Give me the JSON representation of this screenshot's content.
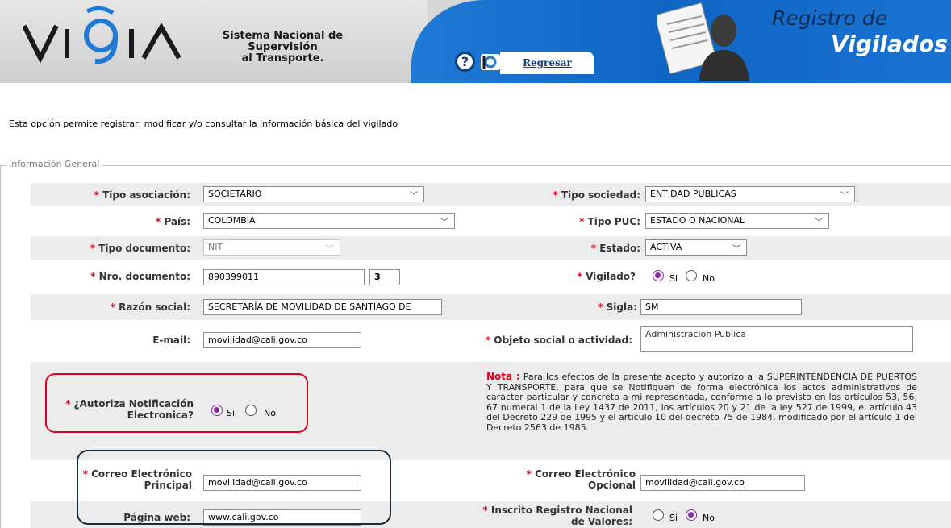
{
  "header": {
    "logo_text_line1": "Sistema Nacional de Supervisión",
    "logo_text_line2": "al Transporte.",
    "help_icon": "question-icon",
    "regresar_label": "Regresar",
    "title_line1": "Registro de",
    "title_line2": "Vigilados"
  },
  "intro_text": "Esta opción permite registrar, modificar y/o consultar la información básica del vigilado",
  "legend": "Información General",
  "required_mark": "*",
  "form": {
    "tipo_asociacion": {
      "label": "Tipo asociación:",
      "value": "SOCIETARIO"
    },
    "tipo_sociedad": {
      "label": "Tipo sociedad:",
      "value": "ENTIDAD PUBLICAS"
    },
    "pais": {
      "label": "País:",
      "value": "COLOMBIA"
    },
    "tipo_puc": {
      "label": "Tipo PUC:",
      "value": "ESTADO O NACIONAL"
    },
    "tipo_documento": {
      "label": "Tipo documento:",
      "value": "NIT"
    },
    "estado": {
      "label": "Estado:",
      "value": "ACTIVA"
    },
    "nro_documento": {
      "label": "Nro. documento:",
      "value": "890399011",
      "dv": "3"
    },
    "vigilado": {
      "label": "Vigilado?",
      "si": "Si",
      "no": "No",
      "selected": "Si"
    },
    "razon_social": {
      "label": "Razón social:",
      "value": "SECRETARÍA DE MOVILIDAD DE SANTIAGO DE"
    },
    "sigla": {
      "label": "Sigla:",
      "value": "SM"
    },
    "email": {
      "label": "E-mail:",
      "value": "movilidad@cali.gov.co"
    },
    "objeto_social": {
      "label": "Objeto social o actividad:",
      "value": "Administracion Publica"
    },
    "autoriza": {
      "label_line1": "¿Autoriza Notificación",
      "label_line2": "Electronica?",
      "si": "Si",
      "no": "No",
      "selected": "Si"
    },
    "nota_title": "Nota :",
    "nota_text": "Para los efectos de la presente acepto y autorizo a la SUPERINTENDENCIA DE PUERTOS Y TRANSPORTE, para que se Notifiquen de forma electrónica los actos administrativos de carácter particular y concreto a mi representada, conforme a lo previsto en los artículos 53, 56, 67 numeral 1 de la Ley 1437 de 2011, los artículos 20 y 21 de la ley 527 de 1999, el artículo 43 del Decreto 229 de 1995 y el articulo 10 del decreto 75 de 1984, modificado por el artículo 1 del Decreto 2563 de 1985.",
    "correo_principal": {
      "label_line1": "Correo Electrónico",
      "label_line2": "Principal",
      "value": "movilidad@cali.gov.co"
    },
    "correo_opcional": {
      "label_line1": "Correo Electrónico",
      "label_line2": "Opcional",
      "value": "movilidad@cali.gov.co"
    },
    "pagina_web": {
      "label": "Página web:",
      "value": "www.cali.gov.co"
    },
    "inscrito": {
      "label_line1": "Inscrito Registro Nacional",
      "label_line2": "de Valores:",
      "si": "Si",
      "no": "No",
      "selected": "No"
    }
  },
  "colors": {
    "brand_blue": "#0f65c4",
    "required_red": "#e3001b",
    "radio_selected": "#8a2aa6"
  }
}
